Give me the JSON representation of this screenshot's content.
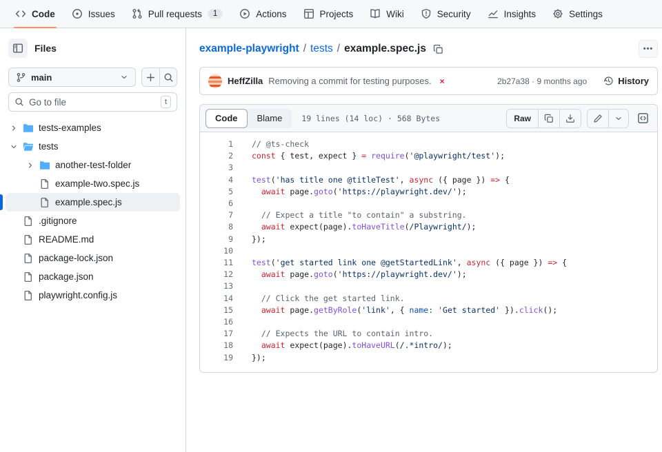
{
  "colors": {
    "accent_orange": "#fd8c73",
    "link_blue": "#0969da",
    "folder_blue": "#54aeff",
    "error_red": "#d1242f"
  },
  "nav": {
    "items": [
      {
        "label": "Code",
        "active": true
      },
      {
        "label": "Issues"
      },
      {
        "label": "Pull requests",
        "badge": "1"
      },
      {
        "label": "Actions"
      },
      {
        "label": "Projects"
      },
      {
        "label": "Wiki"
      },
      {
        "label": "Security"
      },
      {
        "label": "Insights"
      },
      {
        "label": "Settings"
      }
    ]
  },
  "sidebar": {
    "files_label": "Files",
    "branch": "main",
    "search_placeholder": "Go to file",
    "shortcut_key": "t",
    "tree": [
      {
        "label": "tests-examples",
        "type": "folder-collapsed",
        "depth": 0
      },
      {
        "label": "tests",
        "type": "folder-expanded",
        "depth": 0
      },
      {
        "label": "another-test-folder",
        "type": "folder-collapsed",
        "depth": 1
      },
      {
        "label": "example-two.spec.js",
        "type": "file",
        "depth": 1
      },
      {
        "label": "example.spec.js",
        "type": "file",
        "depth": 1,
        "selected": true
      },
      {
        "label": ".gitignore",
        "type": "file",
        "depth": 0
      },
      {
        "label": "README.md",
        "type": "file",
        "depth": 0
      },
      {
        "label": "package-lock.json",
        "type": "file",
        "depth": 0
      },
      {
        "label": "package.json",
        "type": "file",
        "depth": 0
      },
      {
        "label": "playwright.config.js",
        "type": "file",
        "depth": 0
      }
    ]
  },
  "breadcrumb": {
    "repo": "example-playwright",
    "sep1": "/",
    "dir": "tests",
    "sep2": "/",
    "file": "example.spec.js"
  },
  "commit": {
    "author": "HeffZilla",
    "message": "Removing a commit for testing purposes.",
    "status": "×",
    "meta": "2b27a38 · 9 months ago",
    "history_label": "History"
  },
  "toolbar": {
    "code_tab": "Code",
    "blame_tab": "Blame",
    "meta": "19 lines (14 loc) · 568 Bytes",
    "raw_label": "Raw",
    "kebab": "•••"
  },
  "code": {
    "lines": [
      {
        "n": 1,
        "tokens": [
          {
            "c": "cmt",
            "t": "// @ts-check"
          }
        ]
      },
      {
        "n": 2,
        "tokens": [
          {
            "c": "kw",
            "t": "const"
          },
          {
            "c": "pln",
            "t": " { test, expect } "
          },
          {
            "c": "kw",
            "t": "="
          },
          {
            "c": "pln",
            "t": " "
          },
          {
            "c": "fn",
            "t": "require"
          },
          {
            "c": "pln",
            "t": "("
          },
          {
            "c": "str",
            "t": "'@playwright/test'"
          },
          {
            "c": "pln",
            "t": ");"
          }
        ]
      },
      {
        "n": 3,
        "tokens": []
      },
      {
        "n": 4,
        "tokens": [
          {
            "c": "fn",
            "t": "test"
          },
          {
            "c": "pln",
            "t": "("
          },
          {
            "c": "str",
            "t": "'has title one @titleTest'"
          },
          {
            "c": "pln",
            "t": ", "
          },
          {
            "c": "kw",
            "t": "async"
          },
          {
            "c": "pln",
            "t": " ({ page }) "
          },
          {
            "c": "kw",
            "t": "=>"
          },
          {
            "c": "pln",
            "t": " {"
          }
        ]
      },
      {
        "n": 5,
        "tokens": [
          {
            "c": "pln",
            "t": "  "
          },
          {
            "c": "kw",
            "t": "await"
          },
          {
            "c": "pln",
            "t": " page."
          },
          {
            "c": "fn",
            "t": "goto"
          },
          {
            "c": "pln",
            "t": "("
          },
          {
            "c": "str",
            "t": "'https://playwright.dev/'"
          },
          {
            "c": "pln",
            "t": ");"
          }
        ]
      },
      {
        "n": 6,
        "tokens": []
      },
      {
        "n": 7,
        "tokens": [
          {
            "c": "pln",
            "t": "  "
          },
          {
            "c": "cmt",
            "t": "// Expect a title \"to contain\" a substring."
          }
        ]
      },
      {
        "n": 8,
        "tokens": [
          {
            "c": "pln",
            "t": "  "
          },
          {
            "c": "kw",
            "t": "await"
          },
          {
            "c": "pln",
            "t": " expect(page)."
          },
          {
            "c": "fn",
            "t": "toHaveTitle"
          },
          {
            "c": "pln",
            "t": "("
          },
          {
            "c": "str",
            "t": "/Playwright/"
          },
          {
            "c": "pln",
            "t": ");"
          }
        ]
      },
      {
        "n": 9,
        "tokens": [
          {
            "c": "pln",
            "t": "});"
          }
        ]
      },
      {
        "n": 10,
        "tokens": []
      },
      {
        "n": 11,
        "tokens": [
          {
            "c": "fn",
            "t": "test"
          },
          {
            "c": "pln",
            "t": "("
          },
          {
            "c": "str",
            "t": "'get started link one @getStartedLink'"
          },
          {
            "c": "pln",
            "t": ", "
          },
          {
            "c": "kw",
            "t": "async"
          },
          {
            "c": "pln",
            "t": " ({ page }) "
          },
          {
            "c": "kw",
            "t": "=>"
          },
          {
            "c": "pln",
            "t": " {"
          }
        ]
      },
      {
        "n": 12,
        "tokens": [
          {
            "c": "pln",
            "t": "  "
          },
          {
            "c": "kw",
            "t": "await"
          },
          {
            "c": "pln",
            "t": " page."
          },
          {
            "c": "fn",
            "t": "goto"
          },
          {
            "c": "pln",
            "t": "("
          },
          {
            "c": "str",
            "t": "'https://playwright.dev/'"
          },
          {
            "c": "pln",
            "t": ");"
          }
        ]
      },
      {
        "n": 13,
        "tokens": []
      },
      {
        "n": 14,
        "tokens": [
          {
            "c": "pln",
            "t": "  "
          },
          {
            "c": "cmt",
            "t": "// Click the get started link."
          }
        ]
      },
      {
        "n": 15,
        "tokens": [
          {
            "c": "pln",
            "t": "  "
          },
          {
            "c": "kw",
            "t": "await"
          },
          {
            "c": "pln",
            "t": " page."
          },
          {
            "c": "fn",
            "t": "getByRole"
          },
          {
            "c": "pln",
            "t": "("
          },
          {
            "c": "str",
            "t": "'link'"
          },
          {
            "c": "pln",
            "t": ", { "
          },
          {
            "c": "prop",
            "t": "name:"
          },
          {
            "c": "pln",
            "t": " "
          },
          {
            "c": "str",
            "t": "'Get started'"
          },
          {
            "c": "pln",
            "t": " })."
          },
          {
            "c": "fn",
            "t": "click"
          },
          {
            "c": "pln",
            "t": "();"
          }
        ]
      },
      {
        "n": 16,
        "tokens": []
      },
      {
        "n": 17,
        "tokens": [
          {
            "c": "pln",
            "t": "  "
          },
          {
            "c": "cmt",
            "t": "// Expects the URL to contain intro."
          }
        ]
      },
      {
        "n": 18,
        "tokens": [
          {
            "c": "pln",
            "t": "  "
          },
          {
            "c": "kw",
            "t": "await"
          },
          {
            "c": "pln",
            "t": " expect(page)."
          },
          {
            "c": "fn",
            "t": "toHaveURL"
          },
          {
            "c": "pln",
            "t": "("
          },
          {
            "c": "str",
            "t": "/.*intro/"
          },
          {
            "c": "pln",
            "t": ");"
          }
        ]
      },
      {
        "n": 19,
        "tokens": [
          {
            "c": "pln",
            "t": "});"
          }
        ]
      }
    ]
  }
}
